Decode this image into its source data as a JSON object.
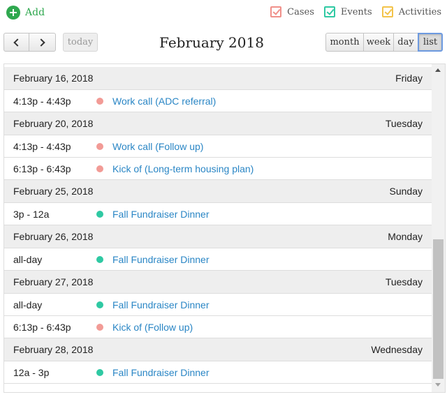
{
  "add": {
    "label": "Add",
    "icon": "plus-circle-icon",
    "color": "#2fa84f"
  },
  "filters": [
    {
      "label": "Cases",
      "checked": true,
      "color": "#f0908a"
    },
    {
      "label": "Events",
      "checked": true,
      "color": "#2fc9a3"
    },
    {
      "label": "Activities",
      "checked": true,
      "color": "#f3c34a"
    }
  ],
  "toolbar": {
    "prev_icon": "chevron-left-icon",
    "next_icon": "chevron-right-icon",
    "today_label": "today",
    "title": "February 2018",
    "views": [
      {
        "label": "month",
        "active": false
      },
      {
        "label": "week",
        "active": false
      },
      {
        "label": "day",
        "active": false
      },
      {
        "label": "list",
        "active": true
      }
    ]
  },
  "colors": {
    "case": "#f29b96",
    "event": "#2fc9a3",
    "link": "#2a86c5"
  },
  "days": [
    {
      "date": "February 16, 2018",
      "weekday": "Friday",
      "events": [
        {
          "time": "4:13p - 4:43p",
          "title": "Work call (ADC referral)",
          "type": "case"
        }
      ]
    },
    {
      "date": "February 20, 2018",
      "weekday": "Tuesday",
      "events": [
        {
          "time": "4:13p - 4:43p",
          "title": "Work call (Follow up)",
          "type": "case"
        },
        {
          "time": "6:13p - 6:43p",
          "title": "Kick of (Long-term housing plan)",
          "type": "case"
        }
      ]
    },
    {
      "date": "February 25, 2018",
      "weekday": "Sunday",
      "events": [
        {
          "time": "3p - 12a",
          "title": "Fall Fundraiser Dinner",
          "type": "event"
        }
      ]
    },
    {
      "date": "February 26, 2018",
      "weekday": "Monday",
      "events": [
        {
          "time": "all-day",
          "title": "Fall Fundraiser Dinner",
          "type": "event"
        }
      ]
    },
    {
      "date": "February 27, 2018",
      "weekday": "Tuesday",
      "events": [
        {
          "time": "all-day",
          "title": "Fall Fundraiser Dinner",
          "type": "event"
        },
        {
          "time": "6:13p - 6:43p",
          "title": "Kick of (Follow up)",
          "type": "case"
        }
      ]
    },
    {
      "date": "February 28, 2018",
      "weekday": "Wednesday",
      "events": [
        {
          "time": "12a - 3p",
          "title": "Fall Fundraiser Dinner",
          "type": "event"
        }
      ]
    }
  ]
}
